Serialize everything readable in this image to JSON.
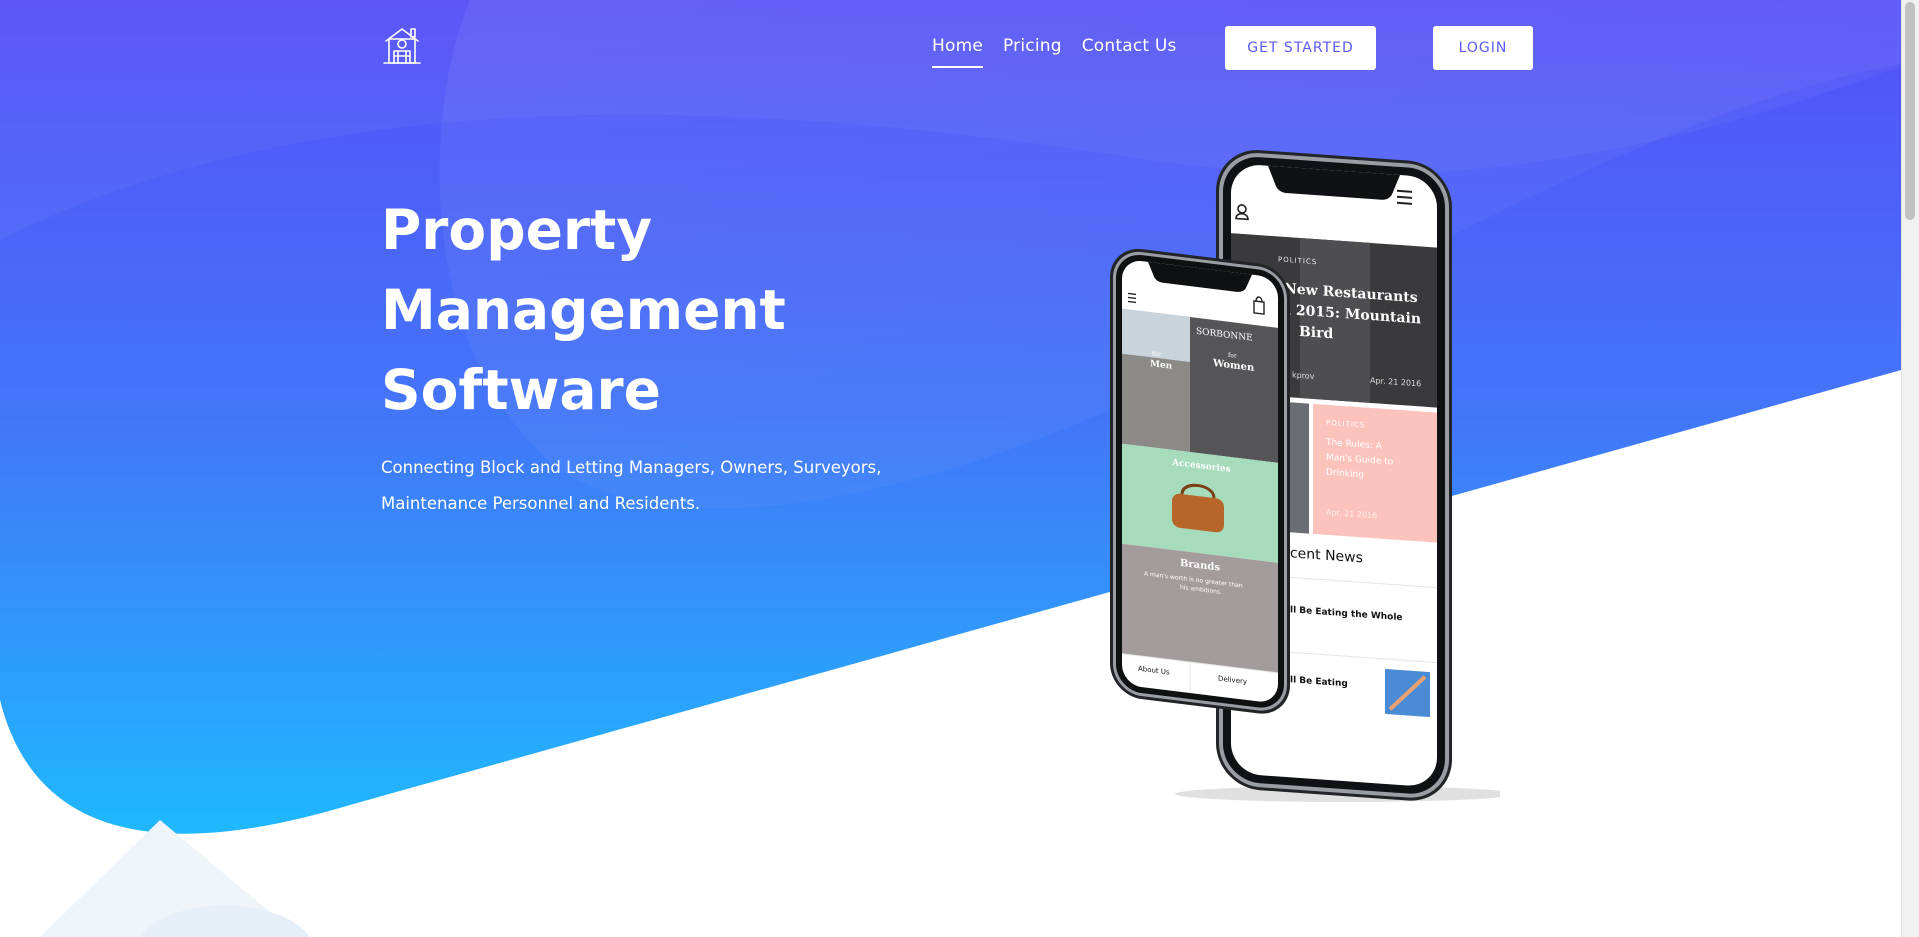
{
  "header": {
    "logo_icon": "house-icon",
    "nav": [
      {
        "label": "Home",
        "active": true
      },
      {
        "label": "Pricing",
        "active": false
      },
      {
        "label": "Contact Us",
        "active": false
      }
    ],
    "get_started_label": "GET STARTED",
    "login_label": "LOGIN"
  },
  "hero": {
    "title_lines": [
      "Property",
      "Management",
      "Software"
    ],
    "subtitle_line1": "Connecting Block and Letting Managers, Owners, Surveyors,",
    "subtitle_line2": "Maintenance Personnel and Residents."
  },
  "phone_back": {
    "category1": "POLITICS",
    "headline_lines": [
      "New Restaurants",
      "a 2015: Mountain",
      "Bird"
    ],
    "author": "kprov",
    "date1": "Apr. 21 2016",
    "category2": "POLITICS",
    "card_lines": [
      "The Rules: A",
      "Man's Guide to",
      "Drinking"
    ],
    "date2": "Apr. 21 2016",
    "section_title": "cent News",
    "item1": "ll Be Eating the Whole",
    "item2": "ll Be Eating"
  },
  "phone_front": {
    "tile_men_small": "for",
    "tile_men": "Men",
    "tile_sorbonne": "SORBONNE",
    "tile_women_small": "for",
    "tile_women": "Women",
    "tile_accessories": "Accessories",
    "tile_brands": "Brands",
    "tile_brands_sub_line1": "A man's worth is no greater than",
    "tile_brands_sub_line2": "his ambitions.",
    "footer_left": "About Us",
    "footer_right": "Delivery"
  },
  "colors": {
    "gradient_top": "#5650f7",
    "gradient_bottom": "#1fb8fd",
    "button_text": "#5b5cf4"
  }
}
